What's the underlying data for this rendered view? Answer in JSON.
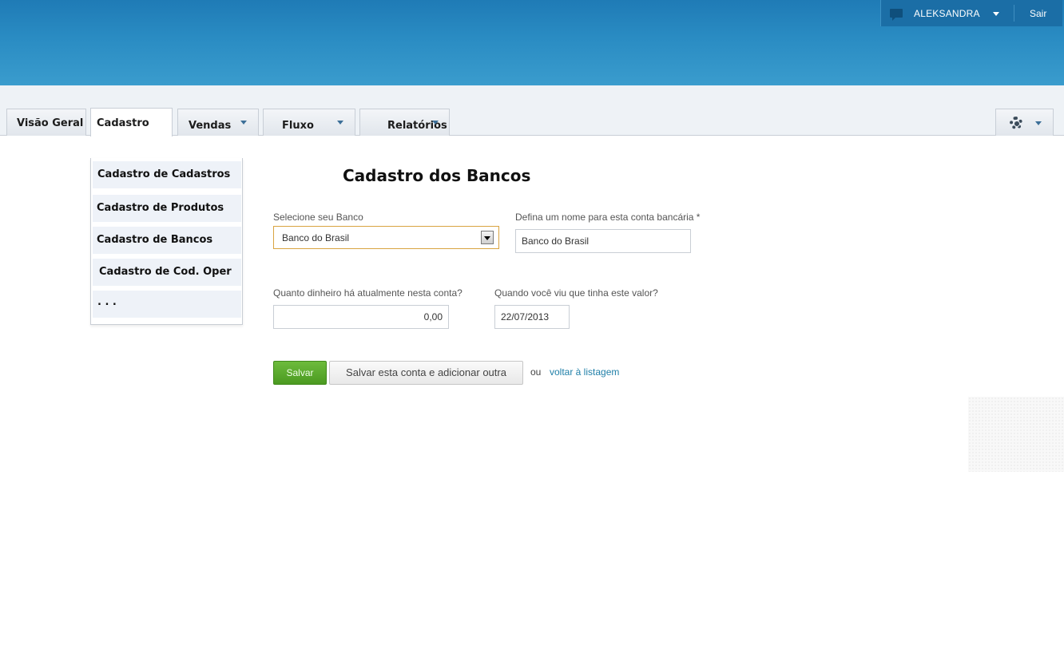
{
  "header": {
    "user_name": "ALEKSANDRA",
    "logout_label": "Sair",
    "banner_color": "#2a8cc3"
  },
  "tabs": [
    {
      "label": "Visão Geral"
    },
    {
      "label": "Cadastro",
      "active": true
    },
    {
      "label": "Vendas"
    },
    {
      "label": "Fluxo"
    },
    {
      "label": "Relatórios"
    }
  ],
  "dropdown": {
    "items": [
      {
        "label": "Cadastro de Cadastros"
      },
      {
        "label": "Cadastro de Produtos"
      },
      {
        "label": "Cadastro de Bancos"
      },
      {
        "label": "Cadastro de Cod. Oper"
      },
      {
        "label": ". . ."
      }
    ]
  },
  "form": {
    "title": "Cadastro dos Bancos",
    "bank_select": {
      "label": "Selecione seu Banco",
      "value": "Banco do Brasil"
    },
    "account_name": {
      "label": "Defina um nome para esta conta bancária *",
      "value": "Banco do Brasil"
    },
    "balance": {
      "label": "Quanto dinheiro há atualmente nesta conta?",
      "value": "0,00"
    },
    "balance_date": {
      "label": "Quando você viu que tinha este valor?",
      "value": "22/07/2013"
    },
    "save_label": "Salvar",
    "save_and_add_label": "Salvar esta conta e adicionar outra",
    "or_label": "ou",
    "back_link_label": "voltar à listagem",
    "save_color": "#4b9a21"
  }
}
